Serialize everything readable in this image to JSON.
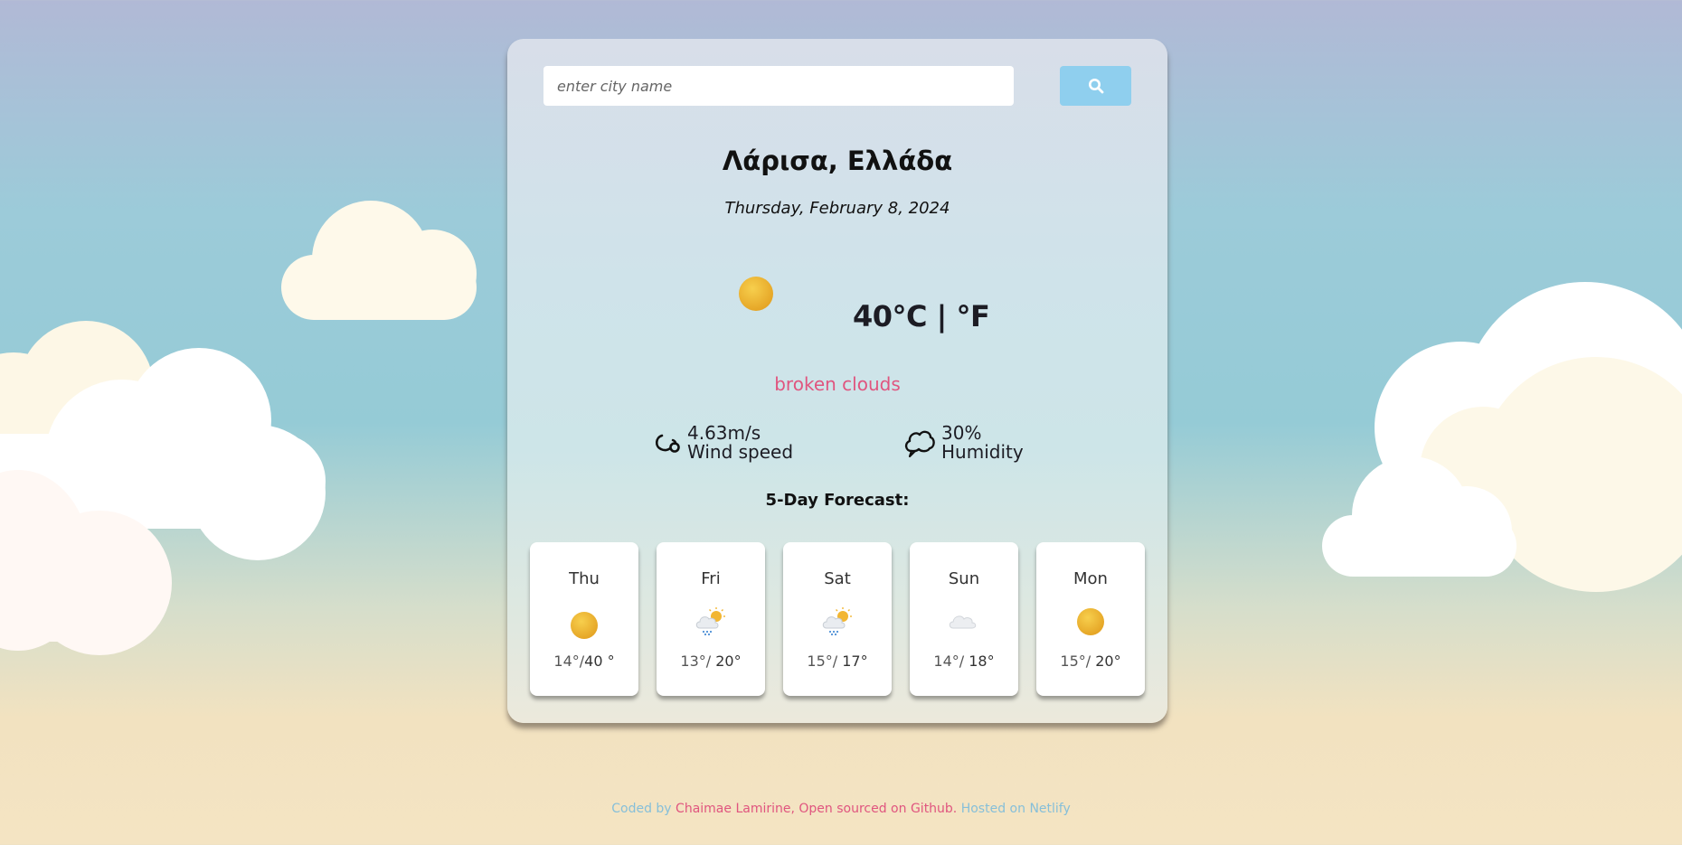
{
  "search": {
    "placeholder": "enter city name",
    "value": "",
    "button_icon": "search-icon"
  },
  "location": {
    "city": "Λάρισα, Ελλάδα",
    "date": "Thursday, February 8, 2024"
  },
  "current": {
    "icon": "sun-icon",
    "temperature": "40",
    "unit_c": "°C",
    "separator": " | ",
    "unit_f": "°F",
    "description": "broken clouds",
    "wind_value": "4.63m/s",
    "wind_label": "Wind speed",
    "wind_icon": "wind-icon",
    "humidity_value": "30%",
    "humidity_label": "Humidity",
    "humidity_icon": "cloud-outline-icon"
  },
  "forecast": {
    "title": "5-Day Forecast:",
    "days": [
      {
        "day": "Thu",
        "icon": "sun-icon",
        "min": "14°/",
        "max": "40 °"
      },
      {
        "day": "Fri",
        "icon": "rain-cloud-sun-icon",
        "min": "13°/",
        "max": " 20°"
      },
      {
        "day": "Sat",
        "icon": "rain-cloud-sun-icon",
        "min": "15°/",
        "max": " 17°"
      },
      {
        "day": "Sun",
        "icon": "cloud-icon",
        "min": "14°/",
        "max": " 18°"
      },
      {
        "day": "Mon",
        "icon": "sun-icon",
        "min": "15°/",
        "max": " 20°"
      }
    ]
  },
  "footer": {
    "coded_by": "Coded by ",
    "author": "Chaimae Lamirine",
    "comma": ", ",
    "open_sourced": "Open sourced on Github.",
    "hosted": " Hosted on ",
    "host": "Netlify"
  },
  "colors": {
    "accent_pink": "#e0557f",
    "search_button": "#8fcfee",
    "footer_text": "#86bfd9",
    "sun": "#f0b731"
  }
}
